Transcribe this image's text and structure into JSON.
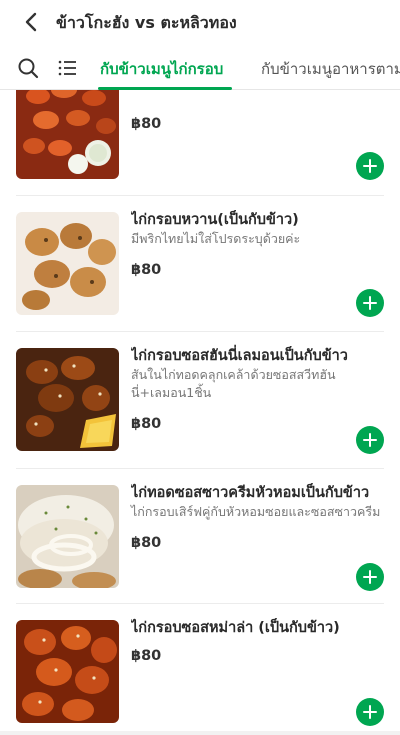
{
  "header": {
    "title": "ข้าวโกะฮัง vs ตะหลิวทอง"
  },
  "tabs": {
    "active": "กับข้าวเมนูไก่กรอบ",
    "next": "กับข้าวเมนูอาหารตาม"
  },
  "colors": {
    "accent": "#00a651"
  },
  "icons": [
    "chevron-left-icon",
    "search-icon",
    "list-icon",
    "plus-icon"
  ],
  "items": [
    {
      "name": "",
      "desc": "",
      "price": "฿80"
    },
    {
      "name": "ไก่กรอบหวาน(เป็นกับข้าว)",
      "desc": "มีพริกไทยไม่ใส่โปรดระบุด้วยค่ะ",
      "price": "฿80"
    },
    {
      "name": "ไก่กรอบซอสฮันนี่เลมอนเป็นกับข้าว",
      "desc": "สันในไก่ทอดคลุกเคล้าด้วยซอสสวีทฮันนี่+เลมอน1ชิ้น",
      "price": "฿80"
    },
    {
      "name": "ไก่ทอดซอสซาวครีมหัวหอมเป็นกับข้าว",
      "desc": "ไก่กรอบเสิร์ฟคู่กับหัวหอมซอยและซอสซาวครีม",
      "price": "฿80"
    },
    {
      "name": "ไก่กรอบซอสหม่าล่า (เป็นกับข้าว)",
      "desc": "",
      "price": "฿80"
    }
  ]
}
